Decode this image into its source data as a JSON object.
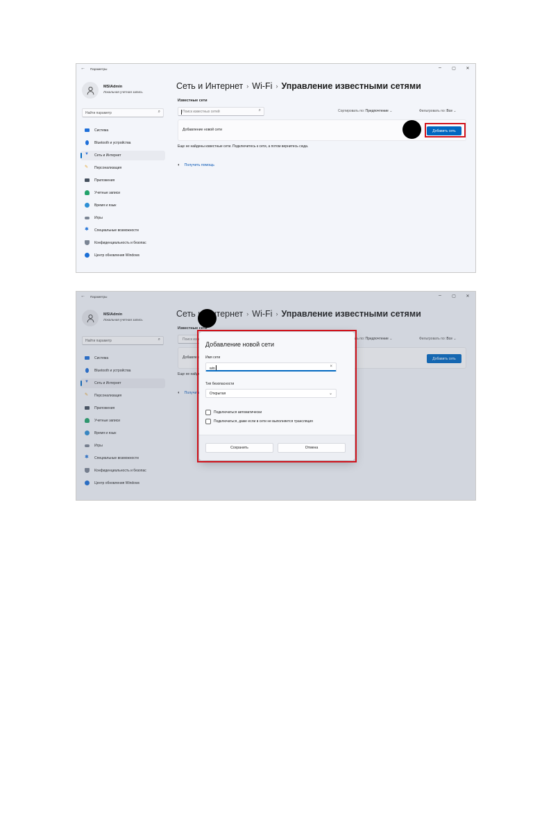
{
  "window": {
    "title": "Параметры",
    "controls": [
      "–",
      "▢",
      "✕"
    ]
  },
  "user": {
    "name": "MSIAdmin",
    "account_type": "Локальная учетная запись"
  },
  "sidebar": {
    "search_placeholder": "Найти параметр",
    "items": [
      {
        "label": "Система",
        "icon": "monitor-icon",
        "color": "#1e6fd9",
        "selected": false
      },
      {
        "label": "Bluetooth и устройства",
        "icon": "bluetooth-icon",
        "color": "#1e6fd9",
        "selected": false
      },
      {
        "label": "Сеть и Интернет",
        "icon": "wifi-icon",
        "color": "#2b6fd6",
        "selected": true
      },
      {
        "label": "Персонализация",
        "icon": "pen-icon",
        "color": "#e3a22a",
        "selected": false
      },
      {
        "label": "Приложения",
        "icon": "apps-icon",
        "color": "#45505e",
        "selected": false
      },
      {
        "label": "Учетные записи",
        "icon": "person-icon",
        "color": "#22a36b",
        "selected": false
      },
      {
        "label": "Время и язык",
        "icon": "globe-clock-icon",
        "color": "#2d8fd5",
        "selected": false
      },
      {
        "label": "Игры",
        "icon": "gamepad-icon",
        "color": "#7b8594",
        "selected": false
      },
      {
        "label": "Специальные возможности",
        "icon": "accessibility-icon",
        "color": "#1b6fd6",
        "selected": false
      },
      {
        "label": "Конфиденциальность и безопас",
        "icon": "shield-icon",
        "color": "#7b8594",
        "selected": false
      },
      {
        "label": "Центр обновления Windows",
        "icon": "update-icon",
        "color": "#1b6fd6",
        "selected": false
      }
    ]
  },
  "breadcrumb": {
    "items": [
      "Сеть и Интернет",
      "Wi-Fi"
    ],
    "current": "Управление известными сетями",
    "separator": "›"
  },
  "main": {
    "known_networks_label": "Известные сети",
    "search_placeholder": "Поиск известных сетей",
    "sort_label": "Сортировать по:",
    "sort_value": "Предпочтение",
    "filter_label": "Фильтровать по:",
    "filter_value": "Все",
    "add_network_label": "Добавление новой сети",
    "add_network_button": "Добавить сеть",
    "no_networks_note": "Еще не найдены известные сети. Подключитесь к сети, а потом вернитесь сюда.",
    "help_link": "Получить помощь"
  },
  "dialog": {
    "title": "Добавление новой сети",
    "network_name_label": "Имя сети",
    "network_name_value": "win",
    "security_type_label": "Тип безопасности",
    "security_type_value": "Открытая",
    "auto_connect_label": "Подключаться автоматически",
    "connect_hidden_label": "Подключаться, даже если в сети не выполняется трансляция",
    "save_button": "Сохранить",
    "cancel_button": "Отмена"
  },
  "colors": {
    "accent": "#0067c0",
    "highlight_box": "#d0121b",
    "step_marker": "#000000"
  }
}
